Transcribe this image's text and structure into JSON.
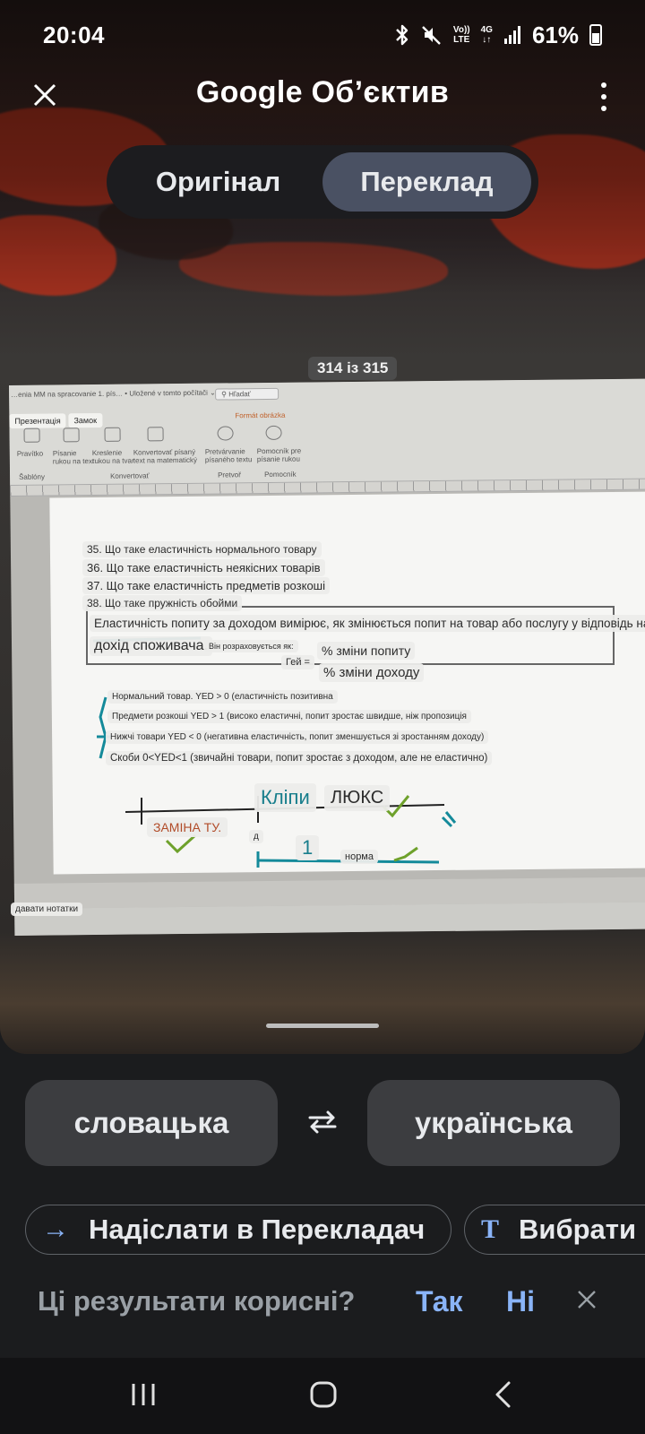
{
  "status_bar": {
    "time": "20:04",
    "net_top": "Vo))",
    "net_bottom": "LTE",
    "gen_top": "4G",
    "gen_bottom": "↓↑",
    "battery": "61%"
  },
  "header": {
    "title": "Google Об’єктив"
  },
  "mode_toggle": {
    "original": "Оригінал",
    "translate": "Переклад",
    "selected": "Переклад"
  },
  "page_counter": "314 із 315",
  "document": {
    "ribbon_tabs": [
      "Презентація",
      "Замок"
    ],
    "ribbon_title": "Formát obrázka",
    "lines": [
      "35. Що таке еластичність нормального товару",
      "36. Що таке еластичність неякісних товарів",
      "37. Що таке еластичність предметів розкоші",
      "38. Що таке пружність обойми"
    ],
    "definition_1": "Еластичність попиту за доходом вимірює, як змінюється попит на товар або послугу у відповідь на зміни.",
    "definition_2": "дохід споживача.",
    "definition_3": "Він розраховується як:",
    "formula_label": "Гей =",
    "numerator": "% зміни попиту",
    "denominator": "% зміни доходу",
    "bullets": [
      "Нормальний товар. YED > 0 (еластичність позитивна",
      "Предмети розкоші YED > 1 (високо еластичні, попит зростає швидше, ніж пропозиція",
      "Нижчі товари YED < 0 (негативна еластичність, попит зменшується зі зростанням доходу)",
      "Скоби 0<YED<1 (звичайні товари, попит зростає з доходом, але не еластично)"
    ],
    "diagram": {
      "label_clips": "Кліпи",
      "label_lux": "ЛЮКС",
      "label_replace": "ЗАМІНА ТУ.",
      "label_d": "д",
      "label_one": "1",
      "label_norm": "норма"
    },
    "notes": "давати нотатки"
  },
  "languages": {
    "source": "словацька",
    "target": "українська"
  },
  "actions": {
    "send": "Надіслати в Перекладач",
    "select": "Вибрати"
  },
  "feedback": {
    "question": "Ці результати корисні?",
    "yes": "Так",
    "no": "Ні"
  },
  "colors": {
    "accent": "#8ab4f8",
    "toggle_active": "#4a5163",
    "panel": "#1b1c1e",
    "button": "#3c3d40"
  },
  "icons": {
    "close": "close-icon",
    "more": "more-vert-icon",
    "swap": "swap-icon",
    "send": "arrow-right-icon",
    "select": "text-select-icon",
    "bluetooth": "bluetooth-icon",
    "mute": "mute-icon",
    "signal": "signal-icon",
    "battery": "battery-icon"
  }
}
